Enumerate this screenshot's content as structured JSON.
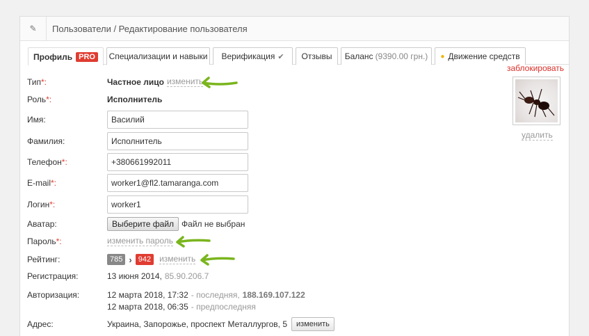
{
  "header": {
    "title": "Пользователи / Редактирование пользователя",
    "icon": "edit-icon"
  },
  "tabs": [
    {
      "label": "Профиль",
      "badge": "PRO"
    },
    {
      "label": "Специализации и навыки"
    },
    {
      "label": "Верификация"
    },
    {
      "label": "Отзывы"
    },
    {
      "label": "Баланс",
      "sub": "(9390.00 грн.)"
    },
    {
      "label": "Движение средств",
      "icon": "shield-icon"
    }
  ],
  "sidebar": {
    "block_label": "заблокировать",
    "delete_label": "удалить"
  },
  "fields": {
    "type": {
      "label": "Тип",
      "value": "Частное лицо",
      "action": "изменить"
    },
    "role": {
      "label": "Роль",
      "value": "Исполнитель"
    },
    "name": {
      "label": "Имя",
      "value": "Василий"
    },
    "surname": {
      "label": "Фамилия",
      "value": "Исполнитель"
    },
    "phone": {
      "label": "Телефон",
      "value": "+380661992011"
    },
    "email": {
      "label": "E-mail",
      "value": "worker1@fl2.tamaranga.com"
    },
    "login": {
      "label": "Логин",
      "value": "worker1"
    },
    "avatar": {
      "label": "Аватар",
      "button": "Выберите файл",
      "status": "Файл не выбран"
    },
    "password": {
      "label": "Пароль",
      "action": "изменить пароль"
    },
    "rating": {
      "label": "Рейтинг",
      "old": "785",
      "new": "942",
      "action": "изменить"
    },
    "registration": {
      "label": "Регистрация",
      "date": "13 июня 2014,",
      "ip": "85.90.206.7"
    },
    "auth": {
      "label": "Авторизация",
      "last_date": "12 марта 2018, 17:32",
      "last_note": "- последняя,",
      "last_ip": "188.169.107.122",
      "prev_date": "12 марта 2018, 06:35",
      "prev_note": "- предпоследняя"
    },
    "address": {
      "label": "Адрес",
      "value": "Украина, Запорожье, проспект Металлургов, 5",
      "action": "изменить"
    }
  },
  "required_mark": "*:",
  "colon": ":"
}
